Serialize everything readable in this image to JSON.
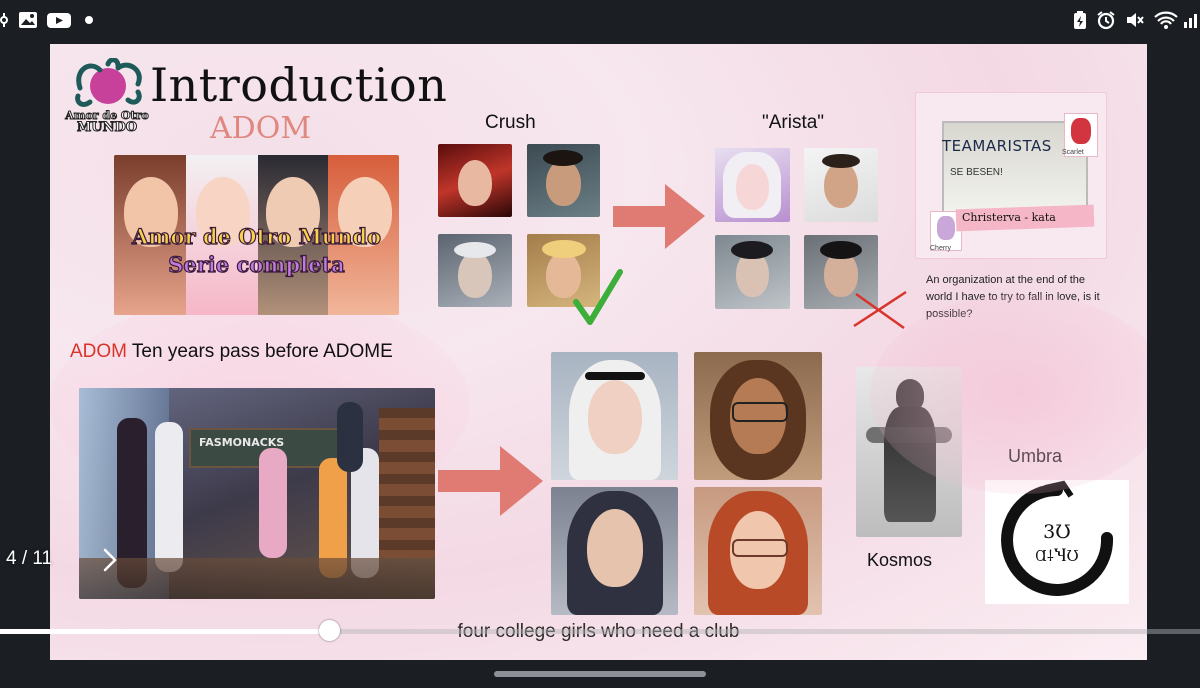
{
  "slide": {
    "title": "Introduction",
    "subtitle": "ADOM",
    "logo_text_line1": "Amor de Otro",
    "logo_text_line2": "MUNDO",
    "cover_text_line1": "Amor de Otro Mundo",
    "cover_text_line2": "Serie completa",
    "crush_label": "Crush",
    "arista_label": "\"Arista\"",
    "note_whiteboard": "TEAMARISTAS",
    "note_whiteboard2": "SE BESEN!",
    "note_name_tag": "Christerva - kata",
    "note_sticker1": "Scarlet",
    "note_sticker2": "Cherry",
    "description": "An organization at the end of the world I have to try to fall in love, is it possible?",
    "adom_prefix": "ADOM",
    "adom_text": " Ten years pass before ADOME",
    "classroom_board": "FASMONACKS",
    "kosmos_label": "Kosmos",
    "umbra_label": "Umbra",
    "umbra_glyph1": "3Ʊ",
    "umbra_glyph2": "Ɑ⸸ႯƱ"
  },
  "player": {
    "page_counter": "4 / 11",
    "caption": "four college girls who need a club",
    "progress": 0.274
  },
  "colors": {
    "accent_red": "#d9342b",
    "arrow": "#e07b74",
    "check": "#3cae3a"
  },
  "icons": [
    "settings-icon",
    "gallery-icon",
    "youtube-icon",
    "dot-icon",
    "battery-icon",
    "alarm-icon",
    "mute-icon",
    "wifi-icon",
    "chevron-right-icon",
    "checkmark-icon",
    "cross-icon",
    "arrow-right-icon"
  ]
}
